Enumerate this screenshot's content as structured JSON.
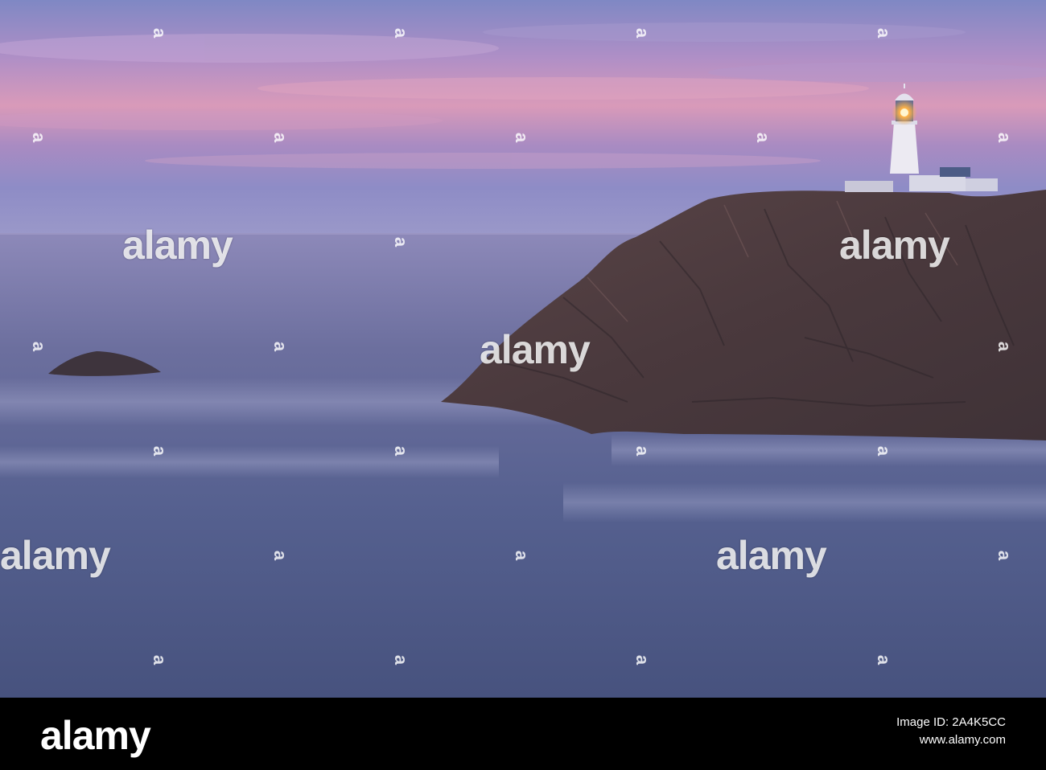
{
  "photo": {
    "subject": "lighthouse-on-cliff-at-dusk",
    "colors": {
      "sky_top": "#7b86be",
      "sky_pink": "#d89ab8",
      "sea": "#4f5b89",
      "cliff": "#4b3a3d",
      "lamp": "#ffb347"
    }
  },
  "watermark": {
    "logo_text": "alamy",
    "small_text": "a"
  },
  "footer": {
    "logo_text": "alamy",
    "image_id_line": "Image ID: 2A4K5CC",
    "site_line": "www.alamy.com"
  }
}
